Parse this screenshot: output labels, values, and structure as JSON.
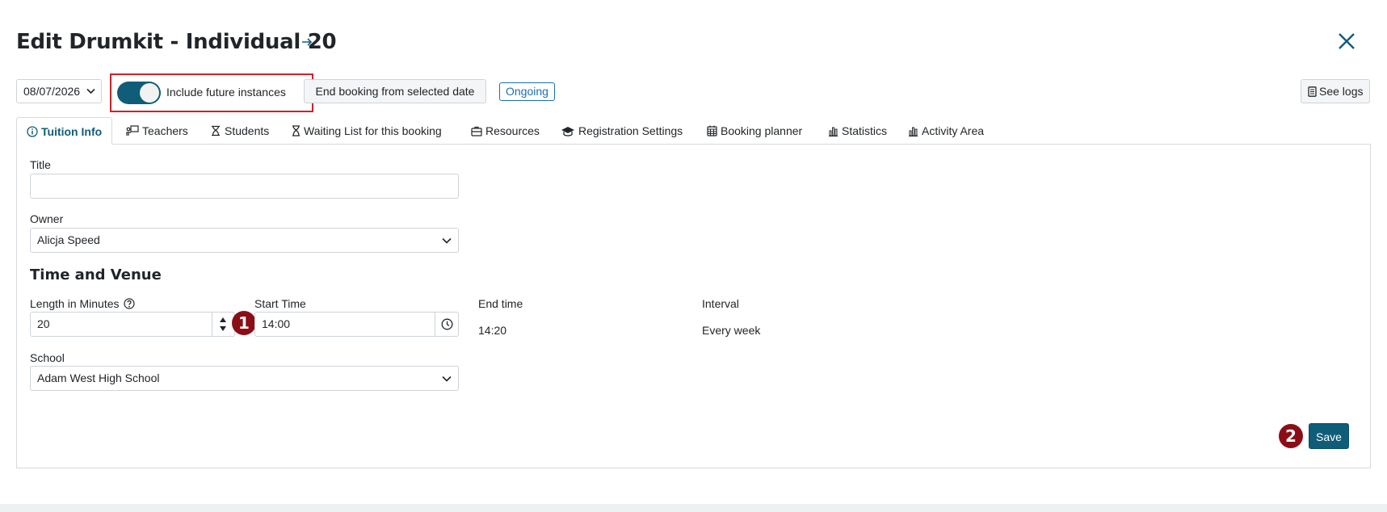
{
  "header": {
    "title": "Edit Drumkit - Individual 20"
  },
  "toolbar": {
    "date_value": "08/07/2026",
    "toggle_label": "Include future instances",
    "toggle_on": true,
    "end_booking_label": "End booking from selected date",
    "status_badge": "Ongoing",
    "see_logs_label": "See logs"
  },
  "tabs": [
    {
      "label": "Tuition Info",
      "icon": "info-circle-icon",
      "active": true
    },
    {
      "label": "Teachers",
      "icon": "teacher-board-icon"
    },
    {
      "label": "Students",
      "icon": "students-icon"
    },
    {
      "label": "Waiting List for this booking",
      "icon": "hourglass-icon"
    },
    {
      "label": "Resources",
      "icon": "briefcase-icon"
    },
    {
      "label": "Registration Settings",
      "icon": "graduation-cap-icon"
    },
    {
      "label": "Booking planner",
      "icon": "calendar-icon"
    },
    {
      "label": "Statistics",
      "icon": "bar-chart-icon"
    },
    {
      "label": "Activity Area",
      "icon": "bar-chart-icon"
    }
  ],
  "form": {
    "title_label": "Title",
    "title_value": "",
    "owner_label": "Owner",
    "owner_value": "Alicja Speed",
    "section_title": "Time and Venue",
    "length_label": "Length in Minutes",
    "length_value": "20",
    "start_time_label": "Start Time",
    "start_time_value": "14:00",
    "end_time_label": "End time",
    "end_time_value": "14:20",
    "interval_label": "Interval",
    "interval_value": "Every week",
    "school_label": "School",
    "school_value": "Adam West High School",
    "save_label": "Save"
  },
  "markers": {
    "one": "1",
    "two": "2"
  },
  "colors": {
    "primary": "#0f5d78",
    "marker": "#8b0e17",
    "highlight_border": "#d0202a",
    "badge": "#1a6fb3"
  }
}
